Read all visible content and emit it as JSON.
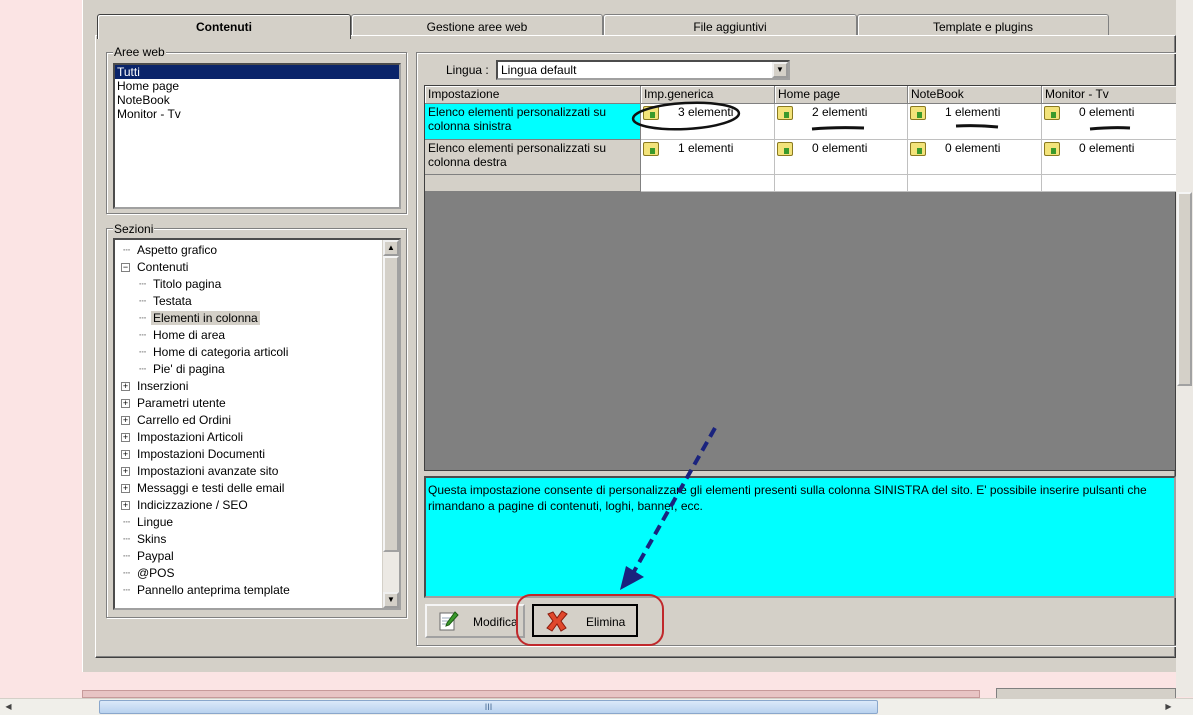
{
  "tabs": [
    "Contenuti",
    "Gestione aree web",
    "File aggiuntivi",
    "Template e plugins"
  ],
  "aree_web": {
    "title": "Aree web",
    "items": [
      "Tutti",
      "Home page",
      "NoteBook",
      "Monitor - Tv"
    ],
    "selected": "Tutti"
  },
  "sezioni": {
    "title": "Sezioni",
    "items": [
      {
        "label": "Aspetto grafico",
        "level": 1,
        "expander": "none"
      },
      {
        "label": "Contenuti",
        "level": 1,
        "expander": "minus"
      },
      {
        "label": "Titolo pagina",
        "level": 2,
        "expander": "none"
      },
      {
        "label": "Testata",
        "level": 2,
        "expander": "none"
      },
      {
        "label": "Elementi in colonna",
        "level": 2,
        "expander": "none",
        "selected": true
      },
      {
        "label": "Home di area",
        "level": 2,
        "expander": "none"
      },
      {
        "label": "Home di categoria articoli",
        "level": 2,
        "expander": "none"
      },
      {
        "label": "Pie' di pagina",
        "level": 2,
        "expander": "none"
      },
      {
        "label": "Inserzioni",
        "level": 1,
        "expander": "plus"
      },
      {
        "label": "Parametri utente",
        "level": 1,
        "expander": "plus"
      },
      {
        "label": "Carrello ed Ordini",
        "level": 1,
        "expander": "plus"
      },
      {
        "label": "Impostazioni Articoli",
        "level": 1,
        "expander": "plus"
      },
      {
        "label": "Impostazioni Documenti",
        "level": 1,
        "expander": "plus"
      },
      {
        "label": "Impostazioni avanzate sito",
        "level": 1,
        "expander": "plus"
      },
      {
        "label": "Messaggi e testi delle email",
        "level": 1,
        "expander": "plus"
      },
      {
        "label": "Indicizzazione / SEO",
        "level": 1,
        "expander": "plus"
      },
      {
        "label": "Lingue",
        "level": 1,
        "expander": "none"
      },
      {
        "label": "Skins",
        "level": 1,
        "expander": "none"
      },
      {
        "label": "Paypal",
        "level": 1,
        "expander": "none"
      },
      {
        "label": "@POS",
        "level": 1,
        "expander": "none"
      },
      {
        "label": "Pannello anteprima template",
        "level": 1,
        "expander": "none"
      }
    ]
  },
  "lingua": {
    "label": "Lingua :",
    "value": "Lingua default"
  },
  "grid": {
    "columns": [
      "Impostazione",
      "Imp.generica",
      "Home page",
      "NoteBook",
      "Monitor - Tv"
    ],
    "rows": [
      {
        "label": "Elenco elementi personalizzati su colonna sinistra",
        "cells": [
          "3 elementi",
          "2 elementi",
          "1 elementi",
          "0 elementi"
        ]
      },
      {
        "label": "Elenco elementi personalizzati su colonna destra",
        "cells": [
          "1 elementi",
          "0 elementi",
          "0 elementi",
          "0 elementi"
        ]
      }
    ]
  },
  "description": "Questa impostazione consente di personalizzare gli elementi presenti sulla colonna SINISTRA del sito. E' possibile inserire pulsanti che rimandano a pagine di contenuti, loghi, banner, ecc.",
  "buttons": {
    "modifica": "Modifica",
    "elimina": "Elimina"
  },
  "colors": {
    "highlight": "#00ffff",
    "selection": "#0a246a",
    "annotation_arrow": "#1a237e",
    "annotation_circle": "#c0282b"
  }
}
